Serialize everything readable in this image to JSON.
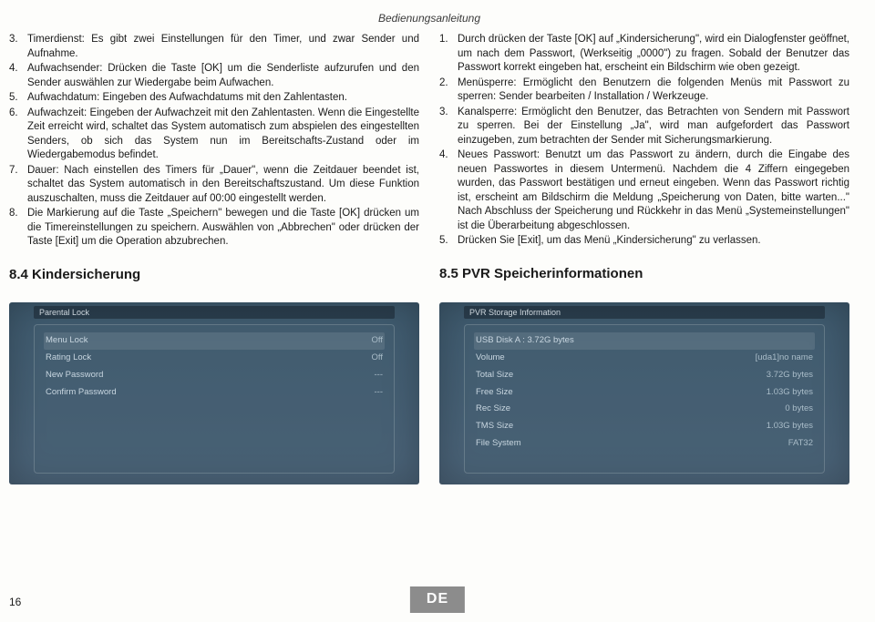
{
  "header": {
    "title": "Bedienungsanleitung"
  },
  "left": {
    "items": [
      {
        "n": "3.",
        "t": "Timerdienst: Es gibt zwei Einstellungen für den Timer, und zwar Sender und Aufnahme."
      },
      {
        "n": "4.",
        "t": "Aufwachsender: Drücken die Taste [OK] um die Senderliste aufzurufen und den Sender auswählen zur Wiedergabe beim Aufwachen."
      },
      {
        "n": "5.",
        "t": "Aufwachdatum: Eingeben des Aufwachdatums mit den Zahlentasten."
      },
      {
        "n": "6.",
        "t": "Aufwachzeit: Eingeben der Aufwachzeit mit den Zahlentasten. Wenn die Eingestellte Zeit erreicht wird, schaltet das System automatisch zum abspielen des eingestellten Senders, ob sich das System nun im Bereitschafts-Zustand oder im Wiedergabemodus befindet."
      },
      {
        "n": "7.",
        "t": "Dauer: Nach einstellen des Timers für „Dauer\", wenn die Zeitdauer beendet ist, schaltet das System automatisch in den Bereitschaftszustand. Um diese Funktion auszuschalten, muss die Zeitdauer auf 00:00 eingestellt werden."
      },
      {
        "n": "8.",
        "t": "Die Markierung auf die Taste „Speichern\" bewegen und die Taste [OK] drücken um die Timereinstellungen zu speichern. Auswählen von „Abbrechen\" oder drücken der Taste [Exit] um die Operation abzubrechen."
      }
    ],
    "heading": "8.4 Kindersicherung"
  },
  "right": {
    "items": [
      {
        "n": "1.",
        "t": "Durch drücken der Taste [OK] auf „Kindersicherung\", wird ein Dialogfenster geöffnet, um nach dem Passwort, (Werkseitig „0000\") zu fragen. Sobald der Benutzer das Passwort korrekt eingeben hat, erscheint ein Bildschirm wie oben gezeigt."
      },
      {
        "n": "2.",
        "t": "Menüsperre: Ermöglicht den Benutzern die folgenden Menüs mit Passwort zu sperren: Sender bearbeiten / Installation / Werkzeuge."
      },
      {
        "n": "3.",
        "t": "Kanalsperre: Ermöglicht den Benutzer, das Betrachten von Sendern mit Passwort zu sperren. Bei der Einstellung „Ja\", wird man aufgefordert das Passwort einzugeben, zum betrachten der Sender mit Sicherungsmarkierung."
      },
      {
        "n": "4.",
        "t": "Neues Passwort: Benutzt um das Passwort zu ändern, durch die Eingabe des neuen Passwortes in diesem Untermenü. Nachdem die 4 Ziffern eingegeben wurden, das Passwort bestätigen und erneut eingeben. Wenn das Passwort richtig ist, erscheint am Bildschirm die Meldung „Speicherung von Daten, bitte warten...\" Nach Abschluss der Speicherung und Rückkehr in das Menü „Systemeinstellungen\" ist die Überarbeitung abgeschlossen."
      },
      {
        "n": "5.",
        "t": "Drücken Sie [Exit], um das Menü „Kindersicherung\" zu verlassen."
      }
    ],
    "heading": "8.5 PVR Speicherinformationen"
  },
  "shotA": {
    "topbar": "Parental Lock",
    "rows": [
      {
        "label": "Menu Lock",
        "val": "Off",
        "sel": true
      },
      {
        "label": "Rating Lock",
        "val": "Off",
        "sel": false
      },
      {
        "label": "New Password",
        "val": "---",
        "sel": false
      },
      {
        "label": "Confirm Password",
        "val": "---",
        "sel": false
      }
    ]
  },
  "shotB": {
    "topbar": "PVR Storage Information",
    "header": "USB Disk A : 3.72G bytes",
    "rows": [
      {
        "label": "Volume",
        "val": "[uda1]no name"
      },
      {
        "label": "Total Size",
        "val": "3.72G bytes"
      },
      {
        "label": "Free Size",
        "val": "1.03G bytes"
      },
      {
        "label": "Rec Size",
        "val": "0 bytes"
      },
      {
        "label": "TMS Size",
        "val": "1.03G bytes"
      },
      {
        "label": "File System",
        "val": "FAT32"
      }
    ]
  },
  "footer": {
    "page": "16",
    "lang": "DE"
  }
}
